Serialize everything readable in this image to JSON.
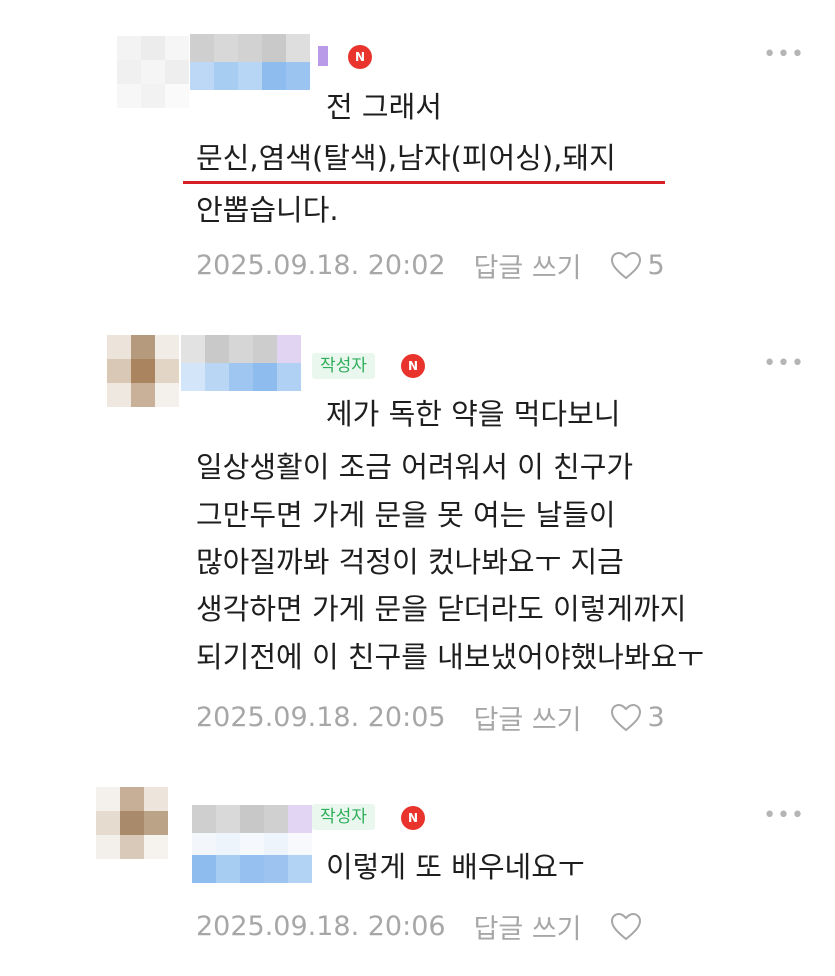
{
  "comments": [
    {
      "has_author_tag": false,
      "badge": "N",
      "first_line": "전 그래서",
      "lines": [
        "문신,염색(탈색),남자(피어싱),돼지",
        "안뽑습니다."
      ],
      "timestamp": "2025.09.18. 20:02",
      "reply_label": "답글 쓰기",
      "like_count": "5"
    },
    {
      "has_author_tag": true,
      "author_tag": "작성자",
      "badge": "N",
      "first_line": "제가 독한 약을 먹다보니",
      "lines": [
        "일상생활이 조금 어려워서 이 친구가",
        "그만두면 가게 문을 못 여는 날들이",
        "많아질까봐 걱정이 컸나봐요ㅜ 지금",
        "생각하면 가게 문을 닫더라도 이렇게까지",
        "되기전에 이 친구를 내보냈어야했나봐요ㅜ"
      ],
      "timestamp": "2025.09.18. 20:05",
      "reply_label": "답글 쓰기",
      "like_count": "3"
    },
    {
      "has_author_tag": true,
      "author_tag": "작성자",
      "badge": "N",
      "first_line": "이렇게 또 배우네요ㅜ",
      "lines": [],
      "timestamp": "2025.09.18. 20:06",
      "reply_label": "답글 쓰기",
      "like_count": ""
    }
  ],
  "icons": {
    "more": "more-dots-icon",
    "like": "heart-outline-icon",
    "badge": "n-badge-icon"
  },
  "colors": {
    "author_tag_text": "#2dae5a",
    "author_tag_bg": "#eaf7ee",
    "badge_red": "#e8342c",
    "meta_gray": "#a7a7a7",
    "highlight_underline": "#d81f26"
  }
}
